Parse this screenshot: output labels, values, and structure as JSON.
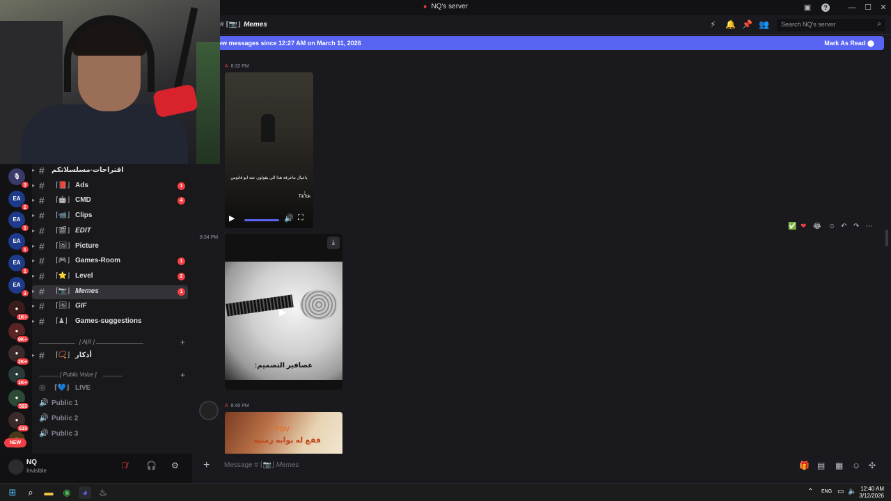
{
  "window": {
    "title": "NQ's server",
    "min": "—",
    "max": "☐",
    "close": "✕",
    "help": "?"
  },
  "header": {
    "channel_prefix": "# ⌈📷⌋",
    "channel_name": "Memes",
    "search_placeholder": "Search NQ's server"
  },
  "new_messages_bar": {
    "text": "ew messages since 12:27 AM on March 11, 2026",
    "action": "Mark As Read"
  },
  "servers": [
    {
      "label": "🎙",
      "badge": "3",
      "color": "#3a3a6a"
    },
    {
      "label": "EA",
      "badge": "2",
      "color": "#1e3a8a"
    },
    {
      "label": "EA",
      "badge": "1",
      "color": "#1e3a8a"
    },
    {
      "label": "EA",
      "badge": "1",
      "color": "#1e3a8a"
    },
    {
      "label": "EA",
      "badge": "1",
      "color": "#1e3a8a"
    },
    {
      "label": "EA",
      "badge": "3",
      "color": "#1e3a8a"
    },
    {
      "label": "●",
      "badge": "1K+",
      "color": "#3b1c1c"
    },
    {
      "label": "●",
      "badge": "9K+",
      "color": "#5a2424"
    },
    {
      "label": "●",
      "badge": "2K+",
      "color": "#3a2a2a"
    },
    {
      "label": "●",
      "badge": "1K+",
      "color": "#2a3a3a"
    },
    {
      "label": "●",
      "badge": "593",
      "color": "#2c4a36"
    },
    {
      "label": "●",
      "badge": "615",
      "color": "#3a2a2a"
    },
    {
      "label": "☀",
      "badge": "",
      "color": "#4a3a1a"
    }
  ],
  "new_label": "NEW",
  "channels": [
    {
      "name": "اقتراحات-مسلسلاتكم",
      "emoji": "",
      "badge": "",
      "italic": false,
      "plain": true,
      "active": false
    },
    {
      "name": "Ads",
      "emoji": "⌈📕⌋",
      "badge": "1",
      "italic": false,
      "plain": false,
      "active": false
    },
    {
      "name": "CMD",
      "emoji": "⌈🤖⌋",
      "badge": "4",
      "italic": false,
      "plain": false,
      "active": false
    },
    {
      "name": "Clips",
      "emoji": "⌈📹⌋",
      "badge": "",
      "italic": false,
      "plain": false,
      "active": false
    },
    {
      "name": "EDIT",
      "emoji": "⌈🎬⌋",
      "badge": "",
      "italic": true,
      "plain": false,
      "active": false
    },
    {
      "name": "Picture",
      "emoji": "⌈🖼⌋",
      "badge": "",
      "italic": false,
      "plain": false,
      "active": false
    },
    {
      "name": "Games-Room",
      "emoji": "⌈🎮⌋",
      "badge": "1",
      "italic": false,
      "plain": false,
      "active": false
    },
    {
      "name": "Level",
      "emoji": "⌈⭐⌋",
      "badge": "2",
      "italic": false,
      "plain": false,
      "active": false
    },
    {
      "name": "Memes",
      "emoji": "⌈📷⌋",
      "badge": "1",
      "italic": true,
      "plain": false,
      "active": true
    },
    {
      "name": "GIF",
      "emoji": "⌈🖼⌋",
      "badge": "",
      "italic": true,
      "plain": false,
      "active": false
    },
    {
      "name": "Games-suggestions",
      "emoji": "⌈♟⌋",
      "badge": "",
      "italic": false,
      "plain": false,
      "active": false
    }
  ],
  "category_ajr": {
    "label": "[ A|R ]",
    "plus": "+"
  },
  "channel_adhkar": {
    "name": "أذكار",
    "emoji": "⌈📿⌋"
  },
  "category_voice": {
    "label": "[ Public Voice ]",
    "plus": "+"
  },
  "voice_channels": [
    {
      "name": "LIVE",
      "emoji": "⌈💙⌋"
    },
    {
      "name": "Public 1"
    },
    {
      "name": "Public 2"
    },
    {
      "name": "Public 3"
    }
  ],
  "user": {
    "name": "NQ",
    "status": "Invisible"
  },
  "messages": {
    "time1": "8:32 PM",
    "video1_caption": "ياعيال ماعرفة هذا الي يقولون عنه ابو فانوس",
    "video1_watermark": "TikTok",
    "time2": "8:34 PM",
    "video2_caption": "عصافير التصميم:",
    "time3": "8:40 PM",
    "image3_pov": "POV",
    "image3_text": "فقع له بوابه زمنيه"
  },
  "composer": {
    "placeholder_prefix": "Message # ⌈📷⌋",
    "placeholder_channel": "Memes"
  },
  "taskbar": {
    "lang": "ENG",
    "time": "12:40 AM",
    "date": "3/12/2026"
  }
}
